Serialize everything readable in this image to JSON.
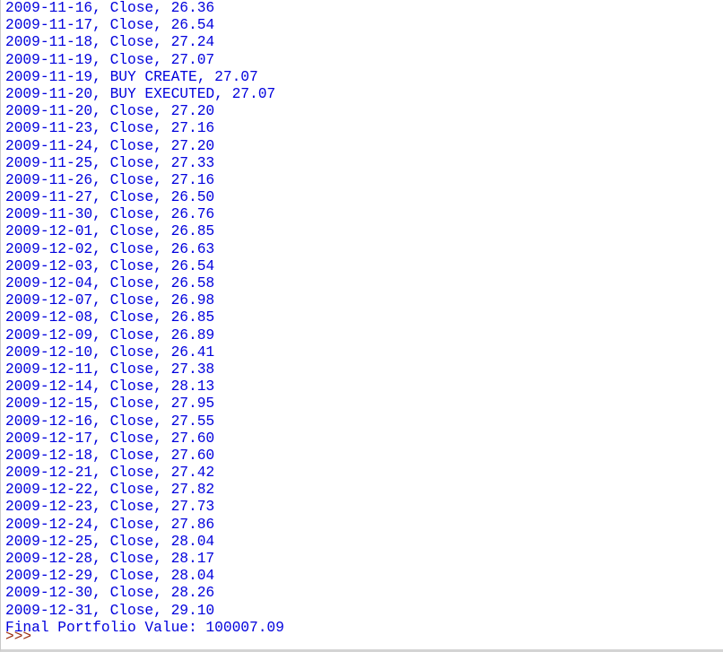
{
  "window": {
    "title": "Python IDLE Shell",
    "app": "idle-shell",
    "text_color": "#0000dd",
    "prompt_color": "#9b2c0f",
    "background_color": "#ffffff",
    "border_color": "#c8c8c8"
  },
  "shell": {
    "prompt": ">>>",
    "prompt_name": "python-prompt",
    "output_lines": [
      "2009-11-16, Close, 26.36",
      "2009-11-17, Close, 26.54",
      "2009-11-18, Close, 27.24",
      "2009-11-19, Close, 27.07",
      "2009-11-19, BUY CREATE, 27.07",
      "2009-11-20, BUY EXECUTED, 27.07",
      "2009-11-20, Close, 27.20",
      "2009-11-23, Close, 27.16",
      "2009-11-24, Close, 27.20",
      "2009-11-25, Close, 27.33",
      "2009-11-26, Close, 27.16",
      "2009-11-27, Close, 26.50",
      "2009-11-30, Close, 26.76",
      "2009-12-01, Close, 26.85",
      "2009-12-02, Close, 26.63",
      "2009-12-03, Close, 26.54",
      "2009-12-04, Close, 26.58",
      "2009-12-07, Close, 26.98",
      "2009-12-08, Close, 26.85",
      "2009-12-09, Close, 26.89",
      "2009-12-10, Close, 26.41",
      "2009-12-11, Close, 27.38",
      "2009-12-14, Close, 28.13",
      "2009-12-15, Close, 27.95",
      "2009-12-16, Close, 27.55",
      "2009-12-17, Close, 27.60",
      "2009-12-18, Close, 27.60",
      "2009-12-21, Close, 27.42",
      "2009-12-22, Close, 27.82",
      "2009-12-23, Close, 27.73",
      "2009-12-24, Close, 27.86",
      "2009-12-25, Close, 28.04",
      "2009-12-28, Close, 28.17",
      "2009-12-29, Close, 28.04",
      "2009-12-30, Close, 28.26",
      "2009-12-31, Close, 29.10",
      "Final Portfolio Value: 100007.09"
    ],
    "final_portfolio_value": "100007.09",
    "final_portfolio_label": "Final Portfolio Value:"
  }
}
